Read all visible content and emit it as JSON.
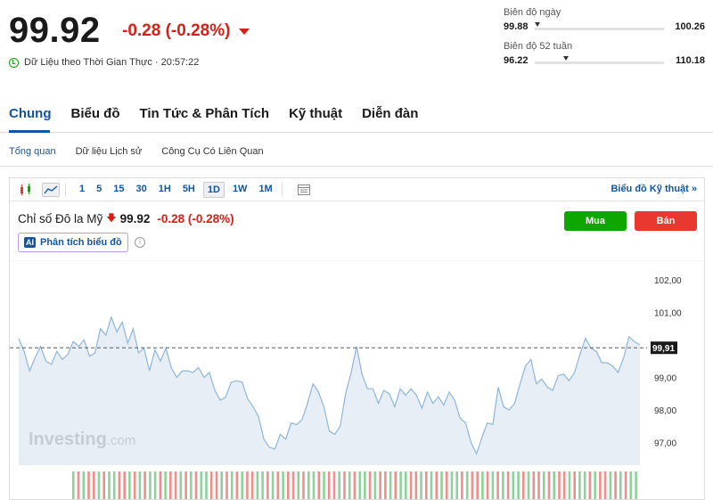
{
  "header": {
    "price": "99.92",
    "change": "-0.28 (-0.28%)",
    "realtime": "Dữ Liệu theo Thời Gian Thực · 20:57:22"
  },
  "ranges": {
    "day": {
      "label": "Biên độ ngày",
      "low": "99.88",
      "high": "100.26",
      "marker": 0.0
    },
    "week52": {
      "label": "Biên độ 52 tuần",
      "low": "96.22",
      "high": "110.18",
      "marker": 0.22
    }
  },
  "tabs": [
    "Chung",
    "Biểu đồ",
    "Tin Tức & Phân Tích",
    "Kỹ thuật",
    "Diễn đàn"
  ],
  "subtabs": [
    "Tổng quan",
    "Dữ liệu Lịch sử",
    "Công Cụ Có Liên Quan"
  ],
  "toolbar": {
    "timeframes": [
      "1",
      "5",
      "15",
      "30",
      "1H",
      "5H",
      "1D",
      "1W",
      "1M"
    ],
    "active": "1D",
    "tech_chart": "Biểu đồ Kỹ thuật »"
  },
  "chart_header": {
    "name": "Chỉ số Đô la Mỹ",
    "value": "99.92",
    "change": "-0.28 (-0.28%)",
    "ai_badge": "AI",
    "ai_label": "Phân tích biểu đồ",
    "buy": "Mua",
    "sell": "Bán",
    "watermark": "Investing",
    "watermark_suffix": ".com"
  },
  "colors": {
    "accent": "#1256a0",
    "up": "#0ea600",
    "down": "#e9382f",
    "line": "#8cb6dc",
    "area": "#e8eef6"
  },
  "chart_data": {
    "type": "area",
    "y_ticks": [
      "102,00",
      "101,00",
      "99,00",
      "98,00",
      "97,00"
    ],
    "ylim": [
      96.3,
      102.6
    ],
    "current_label": "99,91",
    "current_value": 99.91,
    "values": [
      100.2,
      99.8,
      99.2,
      99.6,
      99.95,
      99.5,
      99.4,
      99.8,
      99.55,
      99.7,
      100.1,
      99.95,
      100.15,
      99.65,
      99.75,
      100.5,
      100.3,
      100.85,
      100.4,
      100.7,
      100.05,
      100.5,
      99.75,
      99.9,
      99.2,
      99.85,
      99.5,
      99.9,
      99.3,
      99.0,
      99.2,
      99.2,
      99.15,
      99.3,
      99.0,
      99.15,
      98.6,
      98.3,
      98.4,
      98.85,
      98.9,
      98.85,
      98.35,
      98.1,
      97.8,
      97.1,
      96.85,
      96.8,
      97.25,
      97.1,
      97.6,
      97.55,
      97.7,
      98.2,
      98.8,
      98.55,
      98.1,
      97.35,
      97.25,
      97.5,
      98.5,
      99.15,
      99.95,
      99.1,
      98.65,
      98.65,
      98.2,
      98.6,
      98.5,
      98.1,
      98.65,
      98.45,
      98.65,
      98.45,
      98.05,
      98.55,
      98.2,
      98.4,
      98.15,
      98.55,
      98.3,
      97.75,
      97.6,
      97.0,
      96.65,
      97.15,
      97.6,
      97.55,
      98.7,
      98.1,
      98.0,
      98.2,
      98.8,
      99.35,
      99.55,
      98.8,
      98.95,
      98.7,
      98.6,
      99.05,
      99.1,
      98.9,
      99.15,
      99.7,
      100.2,
      99.9,
      99.8,
      99.45,
      99.45,
      99.35,
      99.15,
      99.6,
      100.25,
      100.1,
      100.0
    ]
  },
  "volume": {
    "pattern": "GRGRRGRGGRRGRGRGGRGRRGRGRGGRRGRGRGRRGGRGRGRRGRGGRGRRGRGRGGRGRRGRGGRRGRGRGRGGRGRRGRGRGRGGRGRRGRGRRGRGGRGRRGRGRGG"
  }
}
